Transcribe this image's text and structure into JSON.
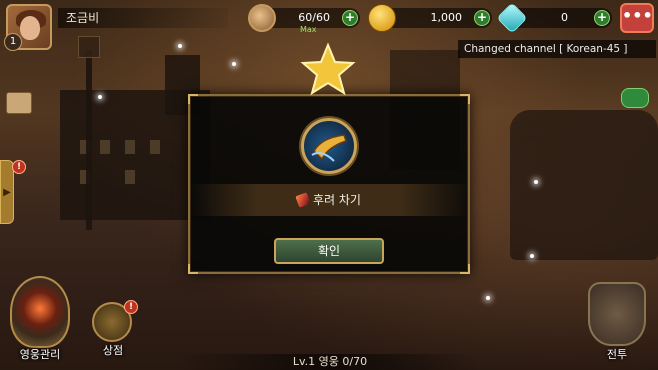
{
  "player": {
    "name": "조금비",
    "level": "1"
  },
  "resources": {
    "stamina": {
      "value": "60/60",
      "sub": "Max"
    },
    "gold": {
      "value": "1,000"
    },
    "gems": {
      "value": "0"
    },
    "plus_label": "+"
  },
  "menu": {
    "icon": "•••"
  },
  "notice": {
    "text": "Changed channel [ Korean-45 ]"
  },
  "side": {
    "tab_arrow": "▶",
    "alert_mark": "!"
  },
  "modal": {
    "skill_name": "후려 차기",
    "confirm_label": "확인"
  },
  "bottom": {
    "hero_label": "영웅관리",
    "shop_label": "상점",
    "battle_label": "전투",
    "hero_count": "Lv.1 영웅 0/70"
  },
  "colors": {
    "accent_gold": "#c9a45a",
    "plus_green": "#2e7d2e",
    "menu_red": "#c3413a"
  }
}
